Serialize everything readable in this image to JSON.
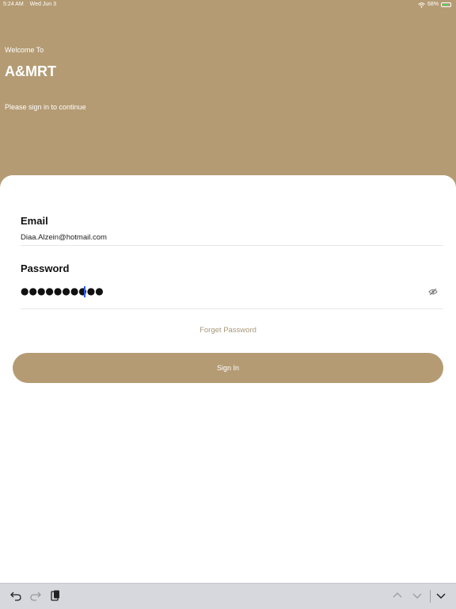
{
  "status_bar": {
    "time": "5:24 AM",
    "date": "Wed Jun 3",
    "battery": "68%"
  },
  "header": {
    "welcome": "Welcome To",
    "brand": "A&MRT",
    "subtitle": "Please sign in to continue"
  },
  "form": {
    "email_label": "Email",
    "email_value": "Diaa.Alzein@hotmail.com",
    "password_label": "Password",
    "password_value": "●●●●●●●●●●",
    "forget_password": "Forget Password",
    "sign_in": "Sign In"
  },
  "colors": {
    "accent": "#b49b73",
    "link": "#a9977a"
  },
  "icons": {
    "eye": "eye-slash-icon",
    "undo": "undo-icon",
    "redo": "redo-icon",
    "paste": "paste-icon",
    "prev": "chevron-up-icon",
    "next": "chevron-down-icon",
    "dismiss": "keyboard-dismiss-icon"
  }
}
